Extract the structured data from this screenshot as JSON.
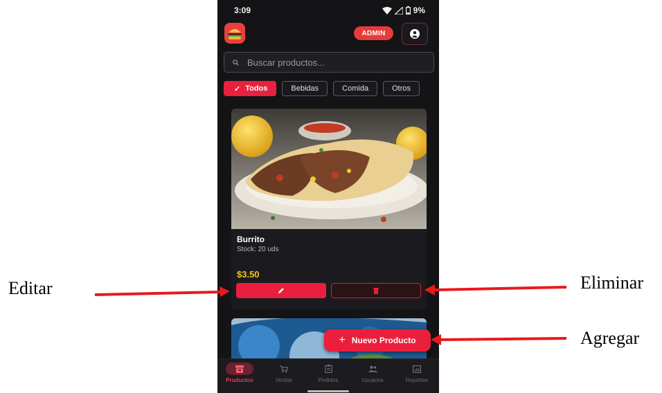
{
  "status_bar": {
    "time": "3:09",
    "battery": "9%"
  },
  "header": {
    "admin_badge": "ADMIN"
  },
  "search": {
    "placeholder": "Buscar productos..."
  },
  "categories": {
    "active": "Todos",
    "items": [
      "Bebidas",
      "Comida",
      "Otros"
    ]
  },
  "product": {
    "name": "Burrito",
    "stock": "Stock: 20 uds",
    "price": "$3.50"
  },
  "fab": {
    "label": "Nuevo Producto"
  },
  "bottom_nav": [
    "Productos",
    "Ventas",
    "Pedidos",
    "Usuarios",
    "Reportes"
  ],
  "annotations": {
    "edit": "Editar",
    "delete": "Eliminar",
    "add": "Agregar"
  },
  "colors": {
    "accent": "#ea1f3d",
    "price": "#f4c21b",
    "background": "#141417",
    "arrow": "#e8191c"
  }
}
